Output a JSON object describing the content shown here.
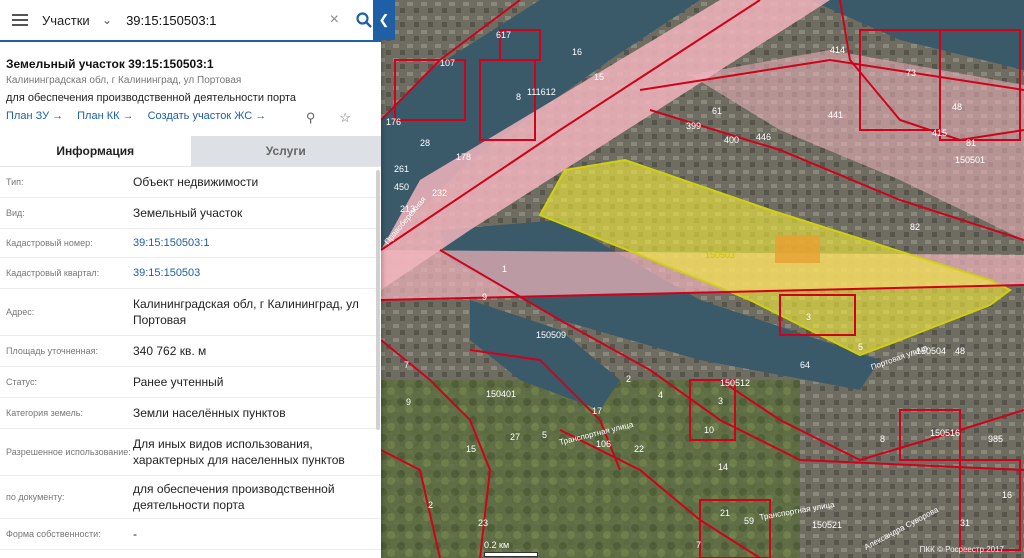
{
  "search": {
    "category": "Участки",
    "query": "39:15:150503:1"
  },
  "card": {
    "title": "Земельный участок 39:15:150503:1",
    "address_short": "Калининградская обл, г Калининград, ул Портовая",
    "purpose": "для обеспечения производственной деятельности порта",
    "links": [
      "План ЗУ →",
      "План КК →",
      "Создать участок ЖС →"
    ]
  },
  "tabs": {
    "info": "Информация",
    "services": "Услуги"
  },
  "properties": [
    {
      "label": "Тип:",
      "value": "Объект недвижимости",
      "link": false
    },
    {
      "label": "Вид:",
      "value": "Земельный участок",
      "link": false
    },
    {
      "label": "Кадастровый номер:",
      "value": "39:15:150503:1",
      "link": true
    },
    {
      "label": "Кадастровый квартал:",
      "value": "39:15:150503",
      "link": true
    },
    {
      "label": "Адрес:",
      "value": "Калининградская обл, г Калининград, ул Портовая",
      "link": false
    },
    {
      "label": "Площадь уточненная:",
      "value": "340 762 кв. м",
      "link": false
    },
    {
      "label": "Статус:",
      "value": "Ранее учтенный",
      "link": false
    },
    {
      "label": "Категория земель:",
      "value": "Земли населённых пунктов",
      "link": false
    },
    {
      "label": "Разрешенное использование:",
      "value": "Для иных видов использования, характерных для населенных пунктов",
      "link": false
    },
    {
      "label": "по документу:",
      "value": "для обеспечения производственной деятельности порта",
      "link": false
    },
    {
      "label": "Форма собственности:",
      "value": "-",
      "link": false
    }
  ],
  "map": {
    "scale_label": "0.2 км",
    "copyright": "ПКК © Росреестр 2017",
    "quarter_labels": [
      "111612",
      "150501",
      "150503",
      "150504",
      "150509",
      "150401",
      "150512",
      "150516",
      "150521"
    ],
    "parcel_labels": [
      "617",
      "107",
      "16",
      "15",
      "8",
      "176",
      "28",
      "178",
      "261",
      "232",
      "450",
      "213",
      "9",
      "1",
      "399",
      "61",
      "400",
      "446",
      "441",
      "414",
      "73",
      "48",
      "415",
      "81",
      "82",
      "3",
      "5",
      "64",
      "4",
      "48",
      "7",
      "9",
      "2",
      "17",
      "27",
      "3",
      "10",
      "15",
      "106",
      "22",
      "14",
      "8",
      "985",
      "16",
      "21",
      "59",
      "7",
      "31",
      "23",
      "5",
      "2"
    ],
    "street_labels": [
      "Транспортная улица",
      "Портовая улица",
      "Транспортная улица",
      "Александра Суворова",
      "Правобережная"
    ],
    "colors": {
      "selected": "#f5ef3a",
      "boundary": "#d0021b",
      "water": "#3a5a6a",
      "public": "#f2b5bd"
    }
  }
}
